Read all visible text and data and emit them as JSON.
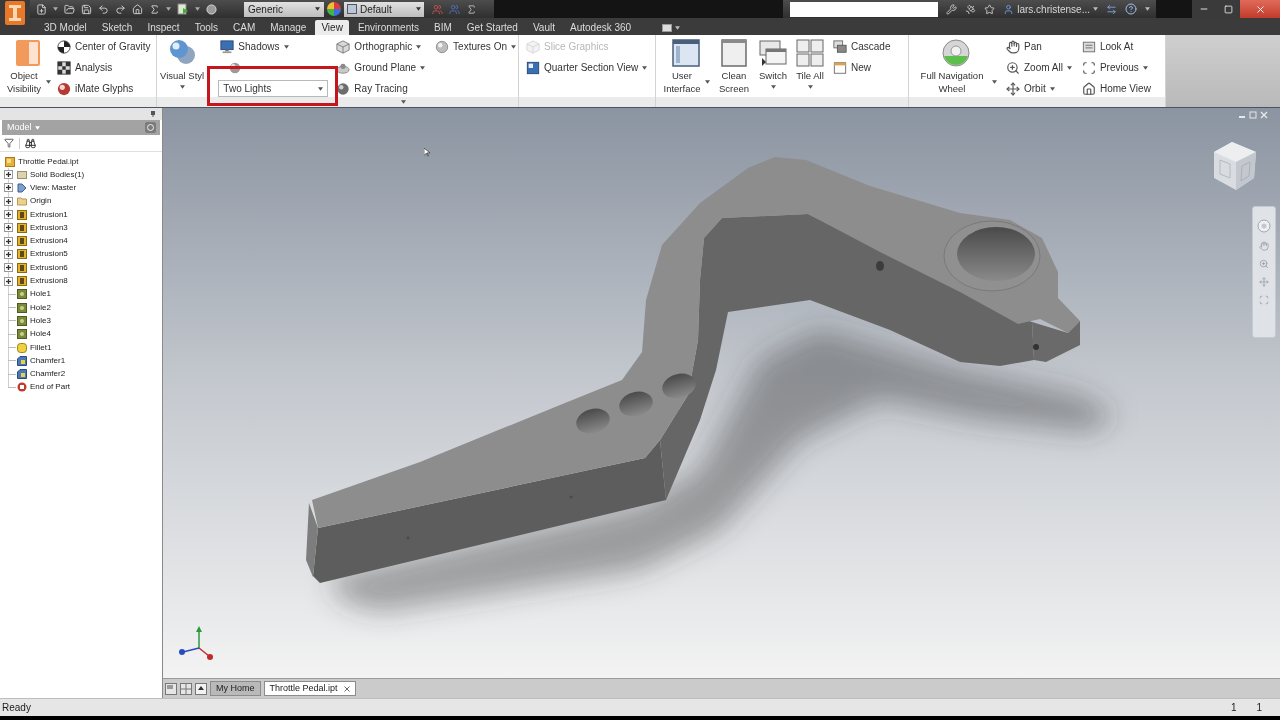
{
  "title_bar": {
    "material_combo": "Generic",
    "appearance_combo": "Default",
    "user": "lars.christense..."
  },
  "tabs": [
    {
      "label": "3D Model",
      "selected": false
    },
    {
      "label": "Sketch",
      "selected": false
    },
    {
      "label": "Inspect",
      "selected": false
    },
    {
      "label": "Tools",
      "selected": false
    },
    {
      "label": "CAM",
      "selected": false
    },
    {
      "label": "Manage",
      "selected": false
    },
    {
      "label": "View",
      "selected": true
    },
    {
      "label": "Environments",
      "selected": false
    },
    {
      "label": "BIM",
      "selected": false
    },
    {
      "label": "Get Started",
      "selected": false
    },
    {
      "label": "Vault",
      "selected": false
    },
    {
      "label": "Autodesk 360",
      "selected": false
    }
  ],
  "ribbon": {
    "panels": [
      {
        "expander": false,
        "columns": [
          [
            {
              "kind": "large",
              "label": "Object Visibility",
              "dropdown": true,
              "disabled": false
            }
          ],
          [
            {
              "kind": "small",
              "label": "Center of Gravity",
              "dropdown": false,
              "disabled": false
            },
            {
              "kind": "small",
              "label": "Analysis",
              "dropdown": false,
              "disabled": false
            },
            {
              "kind": "small",
              "label": "iMate Glyphs",
              "dropdown": false,
              "disabled": false
            }
          ]
        ]
      },
      {
        "expander": true,
        "columns": [
          [
            {
              "kind": "large",
              "label": "Visual Styl",
              "dropdown": true,
              "disabled": false
            }
          ],
          [
            {
              "kind": "small",
              "label": "Shadows",
              "dropdown": true,
              "disabled": false
            },
            {
              "kind": "icon"
            },
            {
              "kind": "combo",
              "label": "Two Lights",
              "highlighted": true
            }
          ],
          [
            {
              "kind": "small",
              "label": "Orthographic",
              "dropdown": true,
              "disabled": false
            },
            {
              "kind": "small",
              "label": "Ground Plane",
              "dropdown": true,
              "disabled": false
            },
            {
              "kind": "small",
              "label": "Ray Tracing",
              "dropdown": false,
              "disabled": false
            }
          ],
          [
            {
              "kind": "small",
              "label": "Textures On",
              "dropdown": true,
              "disabled": false
            }
          ]
        ]
      },
      {
        "expander": false,
        "columns": [
          [
            {
              "kind": "small",
              "label": "Slice Graphics",
              "dropdown": false,
              "disabled": true
            },
            {
              "kind": "small",
              "label": "Quarter Section View",
              "dropdown": true,
              "disabled": false
            }
          ]
        ]
      },
      {
        "expander": false,
        "columns": [
          [
            {
              "kind": "large",
              "label": "User Interface",
              "dropdown": true,
              "disabled": false
            }
          ],
          [
            {
              "kind": "large",
              "label": "Clean Screen",
              "dropdown": false,
              "disabled": false
            }
          ],
          [
            {
              "kind": "large",
              "label": "Switch",
              "dropdown": true,
              "disabled": false
            }
          ],
          [
            {
              "kind": "large",
              "label": "Tile All",
              "dropdown": true,
              "disabled": false
            }
          ],
          [
            {
              "kind": "small",
              "label": "Cascade",
              "dropdown": false,
              "disabled": false
            },
            {
              "kind": "small",
              "label": "New",
              "dropdown": false,
              "disabled": false
            }
          ]
        ]
      },
      {
        "expander": false,
        "columns": [
          [
            {
              "kind": "large",
              "label": "Full Navigation Wheel",
              "dropdown": true,
              "disabled": false
            }
          ],
          [
            {
              "kind": "small",
              "label": "Pan",
              "dropdown": false,
              "disabled": false
            },
            {
              "kind": "small",
              "label": "Zoom All",
              "dropdown": true,
              "disabled": false
            },
            {
              "kind": "small",
              "label": "Orbit",
              "dropdown": true,
              "disabled": false
            }
          ],
          [
            {
              "kind": "small",
              "label": "Look At",
              "dropdown": false,
              "disabled": false
            },
            {
              "kind": "small",
              "label": "Previous",
              "dropdown": true,
              "disabled": false
            },
            {
              "kind": "small",
              "label": "Home View",
              "dropdown": false,
              "disabled": false
            }
          ]
        ]
      }
    ]
  },
  "browser": {
    "title": "Model",
    "tree": [
      {
        "label": "Throttle Pedal.ipt",
        "kind": "part",
        "children": [
          {
            "label": "Solid Bodies(1)",
            "kind": "bodies",
            "expanded": false
          },
          {
            "label": "View: Master",
            "kind": "view",
            "expanded": false
          },
          {
            "label": "Origin",
            "kind": "origin",
            "expanded": false
          },
          {
            "label": "Extrusion1",
            "kind": "extrusion",
            "expanded": false
          },
          {
            "label": "Extrusion3",
            "kind": "extrusion",
            "expanded": false
          },
          {
            "label": "Extrusion4",
            "kind": "extrusion",
            "expanded": false
          },
          {
            "label": "Extrusion5",
            "kind": "extrusion",
            "expanded": false
          },
          {
            "label": "Extrusion6",
            "kind": "extrusion",
            "expanded": false
          },
          {
            "label": "Extrusion8",
            "kind": "extrusion",
            "expanded": false
          },
          {
            "label": "Hole1",
            "kind": "hole"
          },
          {
            "label": "Hole2",
            "kind": "hole"
          },
          {
            "label": "Hole3",
            "kind": "hole"
          },
          {
            "label": "Hole4",
            "kind": "hole"
          },
          {
            "label": "Fillet1",
            "kind": "fillet"
          },
          {
            "label": "Chamfer1",
            "kind": "chamfer"
          },
          {
            "label": "Chamfer2",
            "kind": "chamfer"
          },
          {
            "label": "End of Part",
            "kind": "end"
          }
        ]
      }
    ]
  },
  "document_tabs": [
    {
      "label": "My Home",
      "selected": false
    },
    {
      "label": "Throttle Pedal.ipt",
      "selected": true
    }
  ],
  "status_bar": {
    "text": "Ready",
    "readouts": [
      "1",
      "1"
    ]
  }
}
